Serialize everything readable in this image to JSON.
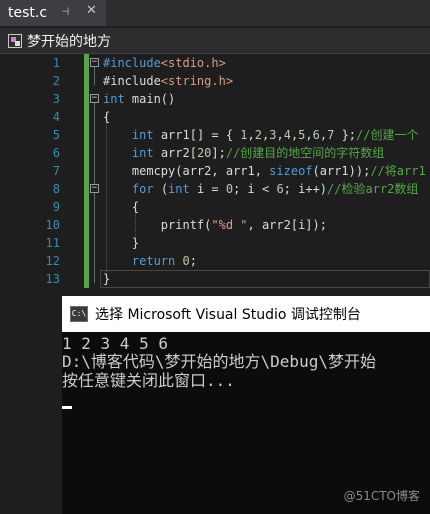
{
  "editor": {
    "tab": {
      "title": "test.c",
      "pin_icon": "⊣",
      "close_icon": "✕"
    },
    "navbar": {
      "scope": "梦开始的地方",
      "icon": "project-icon"
    },
    "lines": [
      {
        "num": "1",
        "tokens": [
          [
            "kw",
            "#include"
          ],
          [
            "str",
            "<stdio.h>"
          ]
        ]
      },
      {
        "num": "2",
        "tokens": [
          [
            "pl",
            "#include"
          ],
          [
            "str",
            "<string.h>"
          ]
        ]
      },
      {
        "num": "3",
        "tokens": [
          [
            "kw",
            "int"
          ],
          [
            "pl",
            " main()"
          ]
        ]
      },
      {
        "num": "4",
        "tokens": [
          [
            "pl",
            "{"
          ]
        ]
      },
      {
        "num": "5",
        "tokens": [
          [
            "pl",
            "    "
          ],
          [
            "kw",
            "int"
          ],
          [
            "pl",
            " arr1[] = { "
          ],
          [
            "num",
            "1"
          ],
          [
            "pl",
            ","
          ],
          [
            "num",
            "2"
          ],
          [
            "pl",
            ","
          ],
          [
            "num",
            "3"
          ],
          [
            "pl",
            ","
          ],
          [
            "num",
            "4"
          ],
          [
            "pl",
            ","
          ],
          [
            "num",
            "5"
          ],
          [
            "pl",
            ","
          ],
          [
            "num",
            "6"
          ],
          [
            "pl",
            ","
          ],
          [
            "num",
            "7"
          ],
          [
            "pl",
            " };"
          ],
          [
            "cm",
            "//创建一个"
          ]
        ]
      },
      {
        "num": "6",
        "tokens": [
          [
            "pl",
            "    "
          ],
          [
            "kw",
            "int"
          ],
          [
            "pl",
            " arr2["
          ],
          [
            "num",
            "20"
          ],
          [
            "pl",
            "];"
          ],
          [
            "cm",
            "//创建目的地空间的字符数组"
          ]
        ]
      },
      {
        "num": "7",
        "tokens": [
          [
            "pl",
            "    memcpy(arr2, arr1, "
          ],
          [
            "kw",
            "sizeof"
          ],
          [
            "pl",
            "(arr1));"
          ],
          [
            "cm",
            "//将arr1"
          ]
        ]
      },
      {
        "num": "8",
        "tokens": [
          [
            "pl",
            "    "
          ],
          [
            "kw",
            "for"
          ],
          [
            "pl",
            " ("
          ],
          [
            "kw",
            "int"
          ],
          [
            "pl",
            " i = "
          ],
          [
            "num",
            "0"
          ],
          [
            "pl",
            "; i < "
          ],
          [
            "num",
            "6"
          ],
          [
            "pl",
            "; i++)"
          ],
          [
            "cm",
            "//检验arr2数组"
          ]
        ]
      },
      {
        "num": "9",
        "tokens": [
          [
            "pl",
            "    {"
          ]
        ]
      },
      {
        "num": "10",
        "tokens": [
          [
            "pl",
            "        printf("
          ],
          [
            "str",
            "\"%d \""
          ],
          [
            "pl",
            ", arr2[i]);"
          ]
        ]
      },
      {
        "num": "11",
        "tokens": [
          [
            "pl",
            "    }"
          ]
        ]
      },
      {
        "num": "12",
        "tokens": [
          [
            "pl",
            "    "
          ],
          [
            "kw",
            "return"
          ],
          [
            "pl",
            " "
          ],
          [
            "num",
            "0"
          ],
          [
            "pl",
            ";"
          ]
        ]
      },
      {
        "num": "13",
        "tokens": [
          [
            "pl",
            "}"
          ]
        ]
      }
    ],
    "colors": {
      "keyword": "#569cd6",
      "string": "#d69d85",
      "comment": "#57a64a",
      "line_number": "#2b91af"
    }
  },
  "console": {
    "title": "选择 Microsoft Visual Studio 调试控制台",
    "icon_text": "C:\\",
    "output": [
      "1 2 3 4 5 6",
      "D:\\博客代码\\梦开始的地方\\Debug\\梦开始",
      "按任意键关闭此窗口..."
    ]
  },
  "watermark": "@51CTO博客"
}
